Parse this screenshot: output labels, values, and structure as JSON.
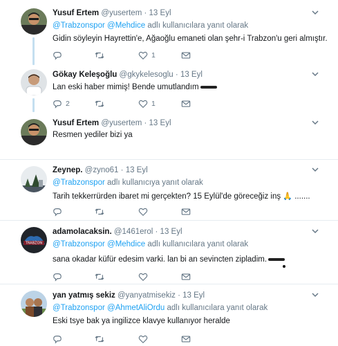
{
  "colors": {
    "link": "#1da1f2",
    "muted": "#657786",
    "divider": "#e6ecf0",
    "thread": "#c4dff0"
  },
  "icons": {
    "reply": "reply-icon",
    "retweet": "retweet-icon",
    "like": "heart-icon",
    "dm": "envelope-icon",
    "more": "chevron-down-icon"
  },
  "tweets": [
    {
      "name": "Yusuf Ertem",
      "handle": "@yusertem",
      "sep": "·",
      "time": "13 Eyl",
      "reply_mentions": [
        "@Trabzonspor",
        "@Mehdice"
      ],
      "reply_suffix": "adlı kullanıcılara yanıt olarak",
      "text": "Gidin söyleyin Hayrettin'e, Ağaoğlu emaneti olan şehr-i Trabzon'u geri almıştır.",
      "reply_count": "",
      "retweet_count": "",
      "like_count": "1"
    },
    {
      "name": "Gökay Keleşoğlu",
      "handle": "@gkykelesoglu",
      "sep": "·",
      "time": "13 Eyl",
      "text": "Lan eski haber mimiş! Bende umutlandım",
      "reply_count": "2",
      "retweet_count": "",
      "like_count": "1"
    },
    {
      "name": "Yusuf Ertem",
      "handle": "@yusertem",
      "sep": "·",
      "time": "13 Eyl",
      "text": "Resmen yediler bizi ya",
      "reply_count": "",
      "retweet_count": "",
      "like_count": ""
    },
    {
      "name": "Zeynep.",
      "handle": "@zyno61",
      "sep": "·",
      "time": "13 Eyl",
      "reply_mentions": [
        "@Trabzonspor"
      ],
      "reply_suffix": "adlı kullanıcıya yanıt olarak",
      "text": "Tarih tekkerrürden ibaret mi gerçekten? 15 Eylül'de göreceğiz inş",
      "text_tail": ".......",
      "reply_count": "",
      "retweet_count": "",
      "like_count": ""
    },
    {
      "name": "adamolacaksin.",
      "handle": "@1461erol",
      "sep": "·",
      "time": "13 Eyl",
      "reply_mentions": [
        "@Trabzonspor",
        "@Mehdice"
      ],
      "reply_suffix": "adlı kullanıcılara yanıt olarak",
      "text": "sana okadar küfür edesim varki. lan bi an sevincten zipladim.",
      "reply_count": "",
      "retweet_count": "",
      "like_count": ""
    },
    {
      "name": "yan yatmış sekiz",
      "handle": "@yanyatmisekiz",
      "sep": "·",
      "time": "13 Eyl",
      "reply_mentions": [
        "@Trabzonspor",
        "@AhmetAliOrdu"
      ],
      "reply_suffix": "adlı kullanıcılara yanıt olarak",
      "text": "Eski tsye bak ya ingilizce klavye kullanıyor heralde",
      "reply_count": "",
      "retweet_count": "",
      "like_count": ""
    }
  ]
}
